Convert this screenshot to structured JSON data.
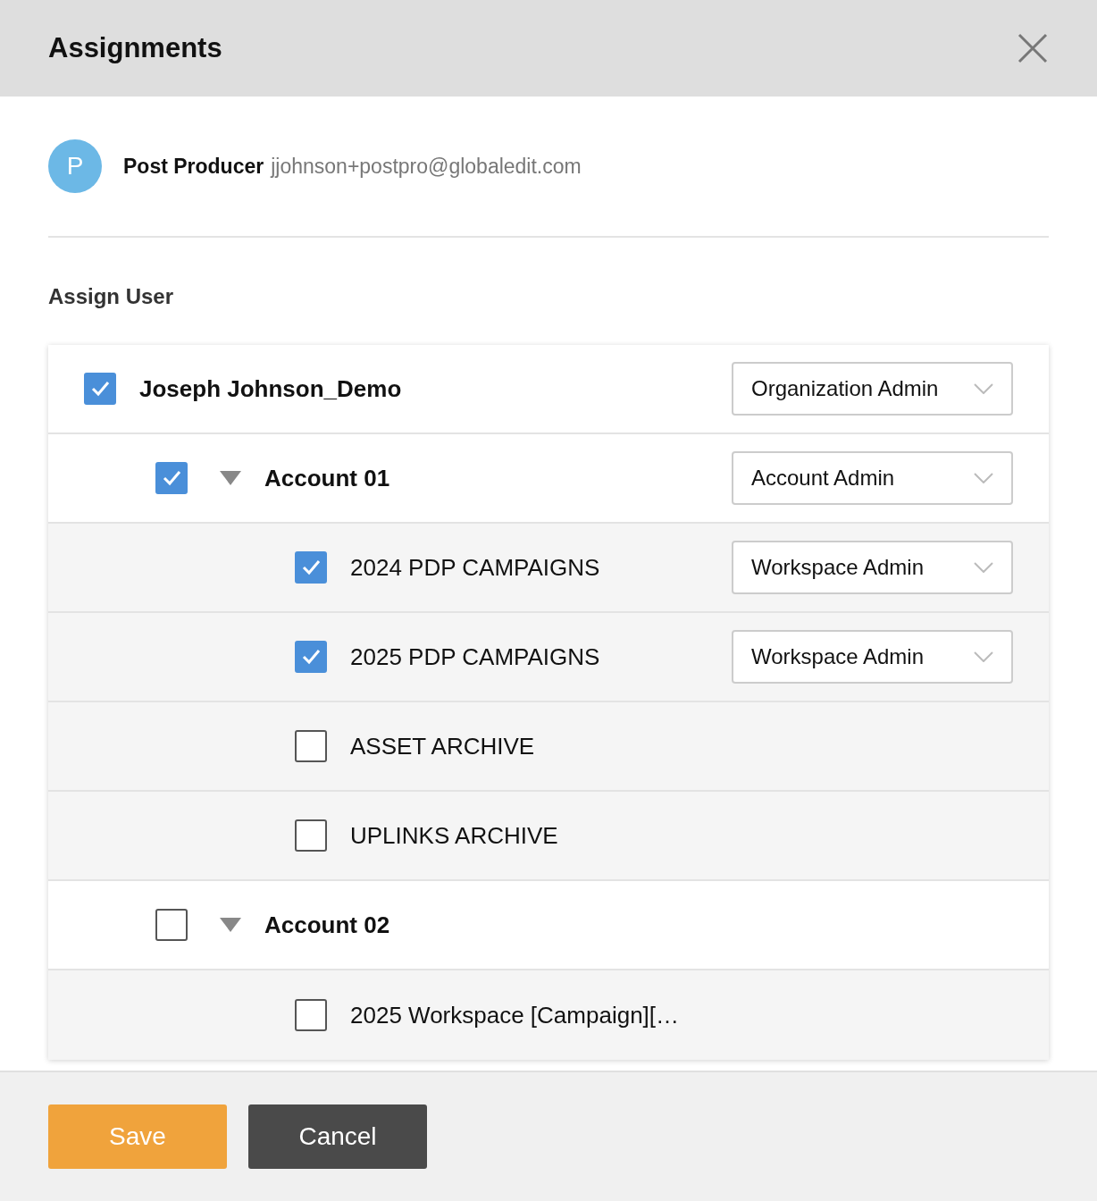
{
  "dialog": {
    "title": "Assignments"
  },
  "user": {
    "avatar_initial": "P",
    "name": "Post Producer",
    "email": "jjohnson+postpro@globaledit.com"
  },
  "section_title": "Assign User",
  "tree": [
    {
      "label": "Joseph Johnson_Demo",
      "checked": true,
      "role": "Organization Admin",
      "children": [
        {
          "label": "Account 01",
          "checked": true,
          "expanded": true,
          "role": "Account Admin",
          "children": [
            {
              "label": "2024 PDP CAMPAIGNS",
              "checked": true,
              "role": "Workspace Admin"
            },
            {
              "label": "2025 PDP CAMPAIGNS",
              "checked": true,
              "role": "Workspace Admin"
            },
            {
              "label": "ASSET ARCHIVE",
              "checked": false
            },
            {
              "label": "UPLINKS ARCHIVE",
              "checked": false
            }
          ]
        },
        {
          "label": "Account 02",
          "checked": false,
          "expanded": true,
          "children": [
            {
              "label": "2025 Workspace [Campaign][…",
              "checked": false
            }
          ]
        }
      ]
    }
  ],
  "buttons": [
    {
      "label": "Save",
      "kind": "primary"
    },
    {
      "label": "Cancel",
      "kind": "secondary"
    }
  ]
}
